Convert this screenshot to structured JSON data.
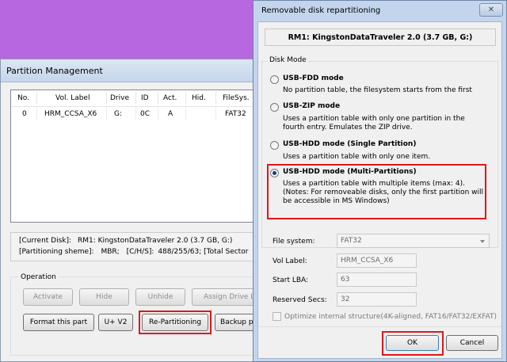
{
  "partition_window": {
    "title": "Partition Management",
    "columns": [
      "No.",
      "Vol. Label",
      "Drive",
      "ID",
      "Act.",
      "Hid.",
      "FileSys."
    ],
    "rows": [
      {
        "no": "0",
        "label": "HRM_CCSA_X6",
        "drive": "G:",
        "id": "0C",
        "act": "A",
        "hid": "",
        "fs": "FAT32"
      }
    ],
    "info": {
      "current_disk_label": "[Current Disk]:",
      "current_disk_value": "RM1: KingstonDataTraveler 2.0 (3.7 GB, G:)",
      "scheme_label": "[Partitioning sheme]:",
      "scheme_value": "MBR;",
      "chs_label": "[C/H/S]:",
      "chs_value": "488/255/63; [Total Sector"
    },
    "operation": {
      "legend": "Operation",
      "activate": "Activate",
      "hide": "Hide",
      "unhide": "Unhide",
      "assign_drive": "Assign Drive Le",
      "format": "Format this part",
      "u_v2": "U+ V2",
      "repartition": "Re-Partitioning",
      "backup": "Backup par"
    }
  },
  "dialog": {
    "title": "Removable disk repartitioning",
    "close_glyph": "✕",
    "disk": "RM1: KingstonDataTraveler 2.0 (3.7 GB, G:)",
    "disk_mode_legend": "Disk Mode",
    "modes": [
      {
        "title": "USB-FDD mode",
        "desc": [
          "No partition table, the filesystem starts from the first"
        ],
        "selected": false
      },
      {
        "title": "USB-ZIP mode",
        "desc": [
          "Uses a partition table with only one partition in the",
          "fourth entry. Emulates the ZIP drive."
        ],
        "selected": false
      },
      {
        "title": "USB-HDD mode (Single Partition)",
        "desc": [
          "Uses a partition table with only one item."
        ],
        "selected": false
      },
      {
        "title": "USB-HDD mode (Multi-Partitions)",
        "desc": [
          "Uses a partition table with multiple items (max: 4).",
          "(Notes: For removeable disks, only the first partition will",
          "be accessible in MS Windows)"
        ],
        "selected": true
      }
    ],
    "file_system_label": "File system:",
    "file_system_value": "FAT32",
    "vol_label_label": "Vol Label:",
    "vol_label_value": "HRM_CCSA_X6",
    "start_lba_label": "Start LBA:",
    "start_lba_value": "63",
    "reserved_label": "Reserved Secs:",
    "reserved_value": "32",
    "optimize_label": "Optimize internal structure(4K-aligned, FAT16/FAT32/EXFAT)",
    "ok": "OK",
    "cancel": "Cancel"
  },
  "colors": {
    "desktop": "#b767e0",
    "highlight": "#e0161b",
    "dialog_frame": "#c2d5ec"
  }
}
